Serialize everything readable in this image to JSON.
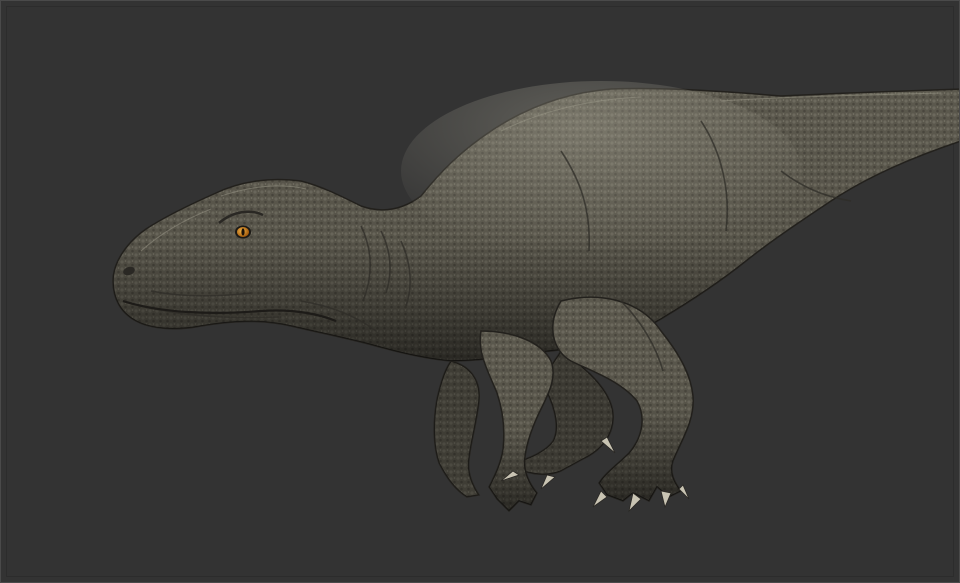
{
  "scene": {
    "subject": "dinosaur-sculpt",
    "background_color": "#333333",
    "frame_color": "#4a4a4a",
    "skin_base_color": "#5e5b50",
    "skin_highlight_color": "#8c8a7e",
    "skin_shadow_color": "#2a2824",
    "eye_color": "#d98a1a"
  }
}
